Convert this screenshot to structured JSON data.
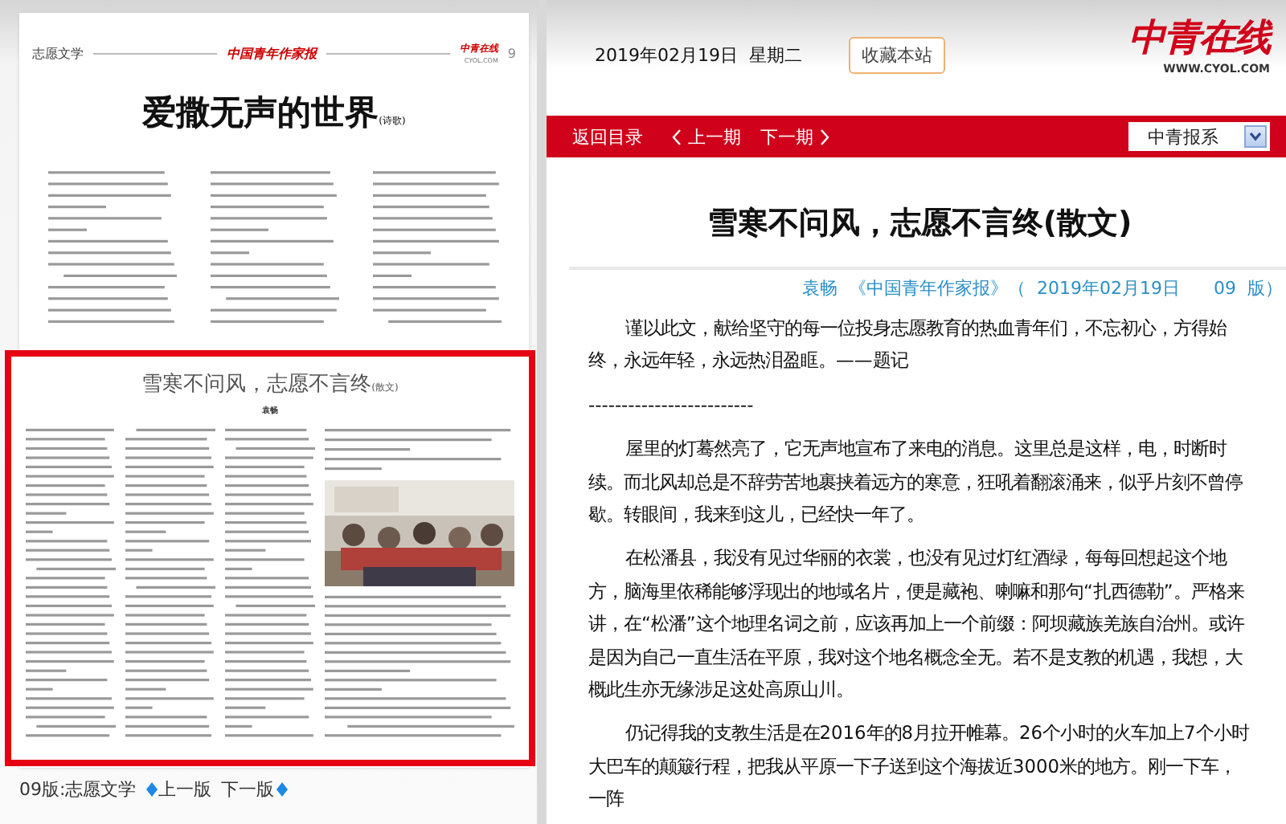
{
  "newspaper": {
    "section": "志愿文学",
    "masthead": "中国青年作家报",
    "corner_logo": "中青在线",
    "corner_url": "CYOL.COM",
    "page_number": "9",
    "headline": "爱撒无声的世界",
    "headline_tag": "(诗歌)",
    "featured": {
      "headline": "雪寒不问风，志愿不言终",
      "tag": "(散文)",
      "author": "袁畅",
      "selected": true
    }
  },
  "page_nav": {
    "page": "09版:志愿文学",
    "prev": "上一版",
    "next": "下一版"
  },
  "header": {
    "date": "2019年02月19日  星期二",
    "bookmark_button": "收藏本站",
    "logo": "中青在线",
    "logo_url": "WWW.CYOL.COM"
  },
  "navbar": {
    "links": [
      {
        "label": "返回目录",
        "kind": "plain"
      },
      {
        "label": "上一期",
        "kind": "prev"
      },
      {
        "label": "下一期",
        "kind": "next"
      }
    ],
    "dropdown": "中青报系"
  },
  "article": {
    "title": "雪寒不问风，志愿不言终(散文)",
    "byline": "袁畅  《中国青年作家报》（  2019年02月19日      09  版）",
    "paragraphs": [
      {
        "kind": "text",
        "text": "谨以此文，献给坚守的每一位投身志愿教育的热血青年们，不忘初心，方得始终，永远年轻，永远热泪盈眶。——题记"
      },
      {
        "kind": "divider",
        "text": "-------------------------"
      },
      {
        "kind": "text",
        "text": "屋里的灯蓦然亮了，它无声地宣布了来电的消息。这里总是这样，电，时断时续。而北风却总是不辞劳苦地裹挟着远方的寒意，狂吼着翻滚涌来，似乎片刻不曾停歇。转眼间，我来到这儿，已经快一年了。"
      },
      {
        "kind": "text",
        "text": "在松潘县，我没有见过华丽的衣裳，也没有见过灯红酒绿，每每回想起这个地方，脑海里依稀能够浮现出的地域名片，便是藏袍、喇嘛和那句“扎西德勒”。严格来讲，在“松潘”这个地理名词之前，应该再加上一个前缀：阿坝藏族羌族自治州。或许是因为自己一直生活在平原，我对这个地名概念全无。若不是支教的机遇，我想，大概此生亦无缘涉足这处高原山川。"
      },
      {
        "kind": "text",
        "text": "仍记得我的支教生活是在2016年的8月拉开帷幕。26个小时的火车加上7个小时大巴车的颠簸行程，把我从平原一下子送到这个海拔近3000米的地方。刚一下车，一阵"
      }
    ]
  }
}
